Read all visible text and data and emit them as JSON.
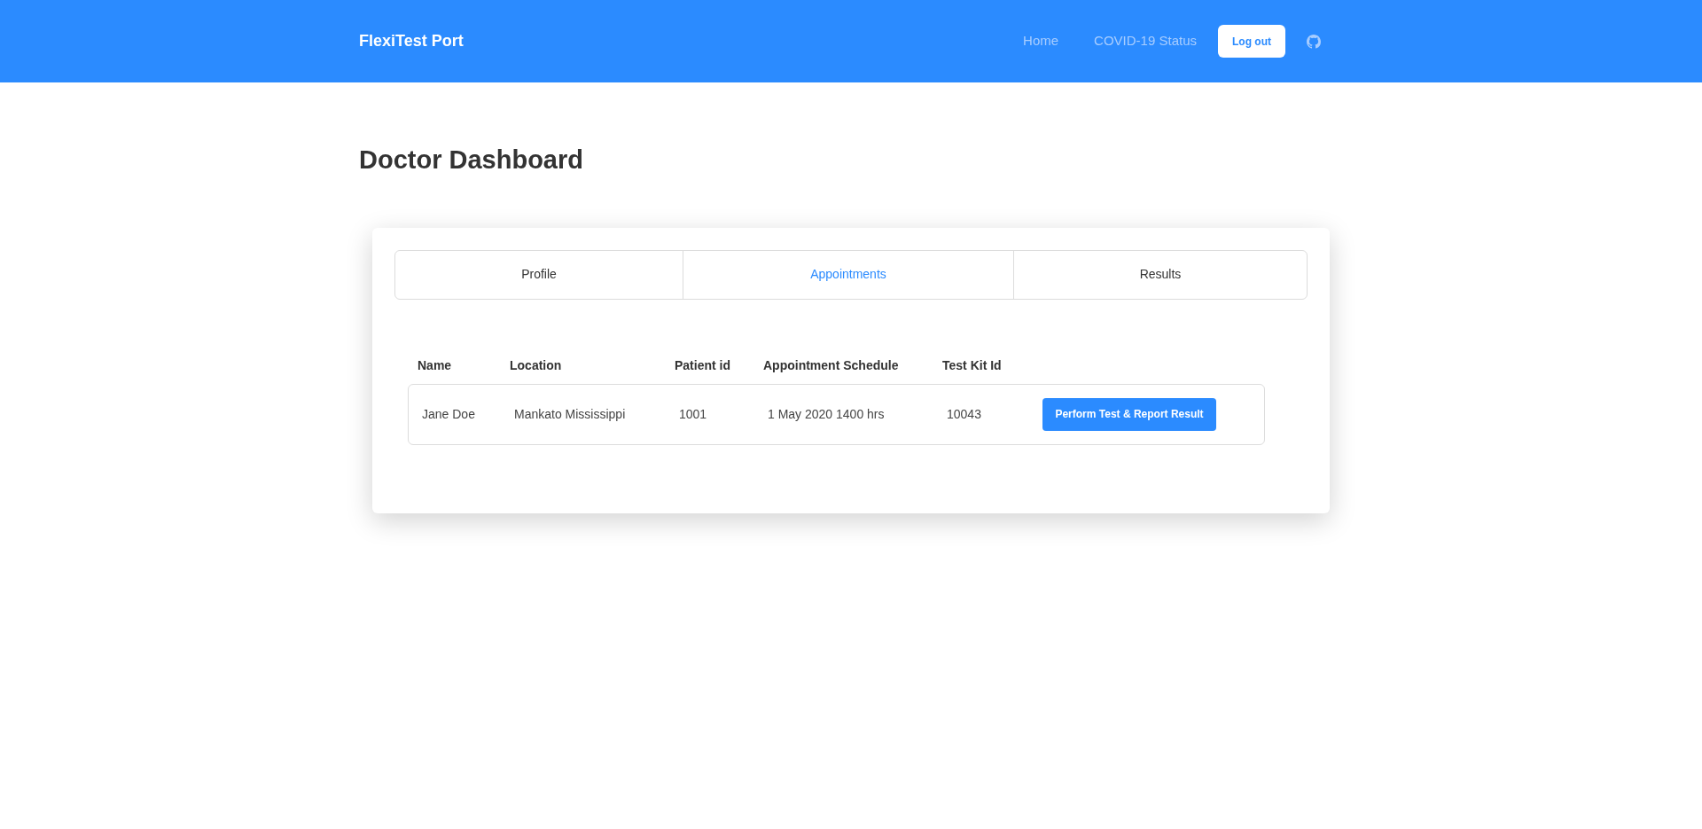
{
  "navbar": {
    "brand": "FlexiTest Port",
    "links": [
      "Home",
      "COVID-19 Status"
    ],
    "logout_button": "Log out"
  },
  "page_title": "Doctor Dashboard",
  "tabs": [
    {
      "label": "Profile",
      "selected": false
    },
    {
      "label": "Appointments",
      "selected": true
    },
    {
      "label": "Results",
      "selected": false
    }
  ],
  "table": {
    "columns": [
      "Name",
      "Location",
      "Patient id",
      "Appointment Schedule",
      "Test Kit Id"
    ],
    "rows": [
      {
        "cells": [
          "Jane Doe",
          "Mankato Mississippi",
          "1001",
          "1 May 2020 1400 hrs",
          "10043"
        ],
        "action": "Perform Test & Report Result"
      }
    ]
  }
}
